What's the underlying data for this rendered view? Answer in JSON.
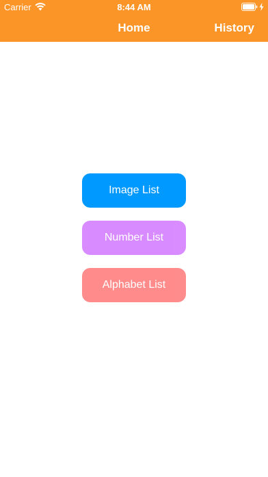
{
  "status_bar": {
    "carrier": "Carrier",
    "time": "8:44 AM"
  },
  "nav": {
    "title": "Home",
    "right_button": "History"
  },
  "menu": {
    "buttons": [
      {
        "label": "Image List",
        "color": "#0099FF"
      },
      {
        "label": "Number List",
        "color": "#D47FFF"
      },
      {
        "label": "Alphabet List",
        "color": "#FF7F7F"
      }
    ]
  },
  "colors": {
    "header": "#FC9528"
  },
  "icons": {
    "wifi": "wifi-icon",
    "battery": "battery-icon",
    "charging": "charging-bolt-icon"
  }
}
